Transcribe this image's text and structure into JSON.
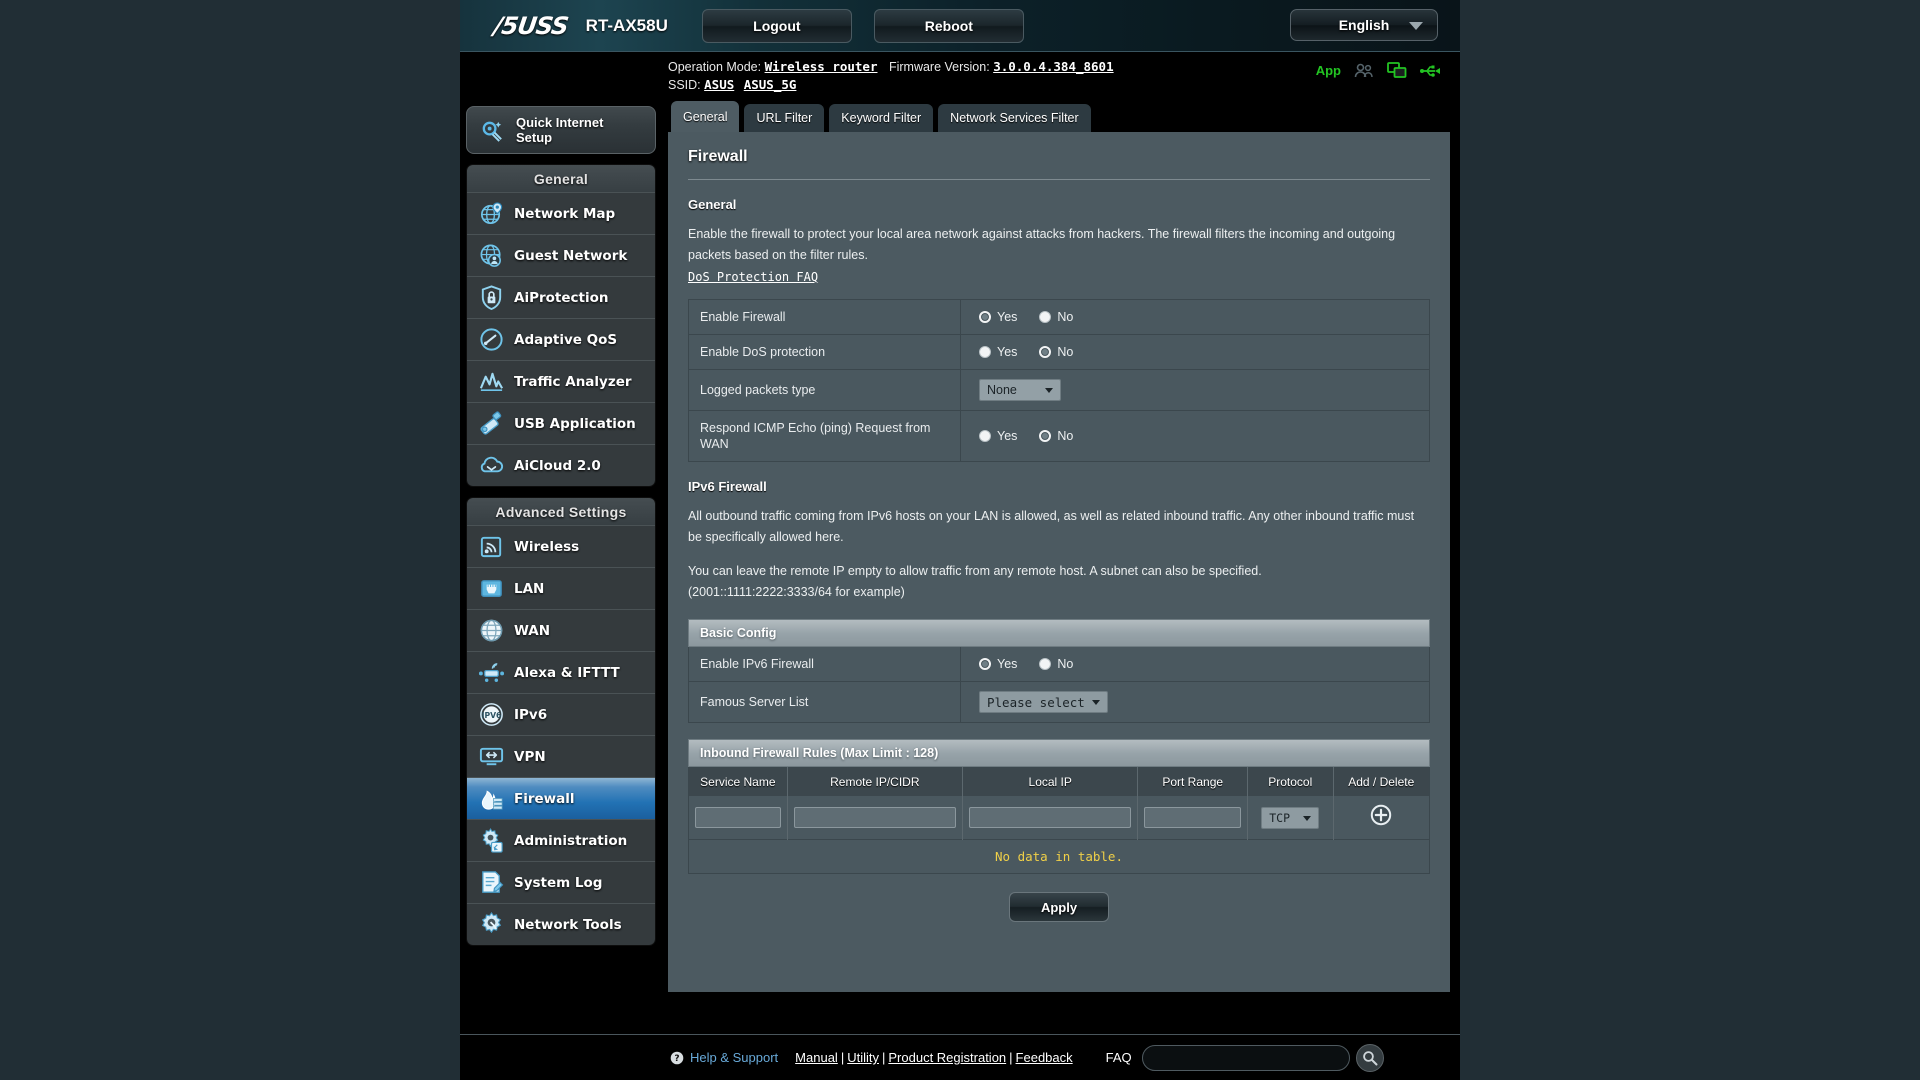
{
  "banner": {
    "brand": "/5USS",
    "brand_text": "ASUS",
    "model": "RT-AX58U",
    "logout_label": "Logout",
    "reboot_label": "Reboot",
    "language": "English"
  },
  "info": {
    "operation_mode_label": "Operation Mode:",
    "operation_mode_value": "Wireless router",
    "firmware_label": "Firmware Version:",
    "firmware_value": "3.0.0.4.384_8601",
    "ssid_label": "SSID:",
    "ssid_1": "ASUS",
    "ssid_2": "ASUS_5G",
    "app_label": "App"
  },
  "sidebar": {
    "quick_setup": "Quick Internet Setup",
    "general_header": "General",
    "general_items": [
      {
        "label": "Network Map",
        "icon": "network-map-icon"
      },
      {
        "label": "Guest Network",
        "icon": "guest-network-icon"
      },
      {
        "label": "AiProtection",
        "icon": "shield-lock-icon"
      },
      {
        "label": "Adaptive QoS",
        "icon": "gauge-icon"
      },
      {
        "label": "Traffic Analyzer",
        "icon": "traffic-chart-icon"
      },
      {
        "label": "USB Application",
        "icon": "usb-icon"
      },
      {
        "label": "AiCloud 2.0",
        "icon": "cloud-icon"
      }
    ],
    "advanced_header": "Advanced Settings",
    "advanced_items": [
      {
        "label": "Wireless",
        "icon": "wireless-icon"
      },
      {
        "label": "LAN",
        "icon": "lan-port-icon"
      },
      {
        "label": "WAN",
        "icon": "globe-icon"
      },
      {
        "label": "Alexa & IFTTT",
        "icon": "alexa-ifttt-icon"
      },
      {
        "label": "IPv6",
        "icon": "ipv6-icon"
      },
      {
        "label": "VPN",
        "icon": "vpn-icon"
      },
      {
        "label": "Firewall",
        "icon": "firewall-flame-icon",
        "active": true
      },
      {
        "label": "Administration",
        "icon": "administration-gear-icon"
      },
      {
        "label": "System Log",
        "icon": "system-log-icon"
      },
      {
        "label": "Network Tools",
        "icon": "network-tools-icon"
      }
    ]
  },
  "tabs": [
    {
      "label": "General",
      "active": true
    },
    {
      "label": "URL Filter",
      "active": false
    },
    {
      "label": "Keyword Filter",
      "active": false
    },
    {
      "label": "Network Services Filter",
      "active": false
    }
  ],
  "page": {
    "title": "Firewall",
    "general_heading": "General",
    "general_desc": "Enable the firewall to protect your local area network against attacks from hackers. The firewall filters the incoming and outgoing packets based on the filter rules.",
    "dos_faq_link": "DoS Protection FAQ",
    "ipv6_heading": "IPv6 Firewall",
    "ipv6_desc_1": "All outbound traffic coming from IPv6 hosts on your LAN is allowed, as well as related inbound traffic. Any other inbound traffic must be specifically allowed here.",
    "ipv6_desc_2": "You can leave the remote IP empty to allow traffic from any remote host. A subnet can also be specified.",
    "ipv6_desc_3": "(2001::1111:2222:3333/64 for example)",
    "basic_config_header": "Basic Config",
    "rules_header": "Inbound Firewall Rules (Max Limit : 128)",
    "no_data": "No data in table.",
    "apply_label": "Apply"
  },
  "settings": {
    "yes_label": "Yes",
    "no_label": "No",
    "rows": [
      {
        "label": "Enable Firewall",
        "type": "radio",
        "selected": "Yes"
      },
      {
        "label": "Enable DoS protection",
        "type": "radio",
        "selected": "No"
      },
      {
        "label": "Logged packets type",
        "type": "select",
        "value": "None"
      },
      {
        "label": "Respond ICMP Echo (ping) Request from WAN",
        "type": "radio",
        "selected": "No"
      }
    ]
  },
  "ipv6_settings": {
    "enable_label": "Enable IPv6 Firewall",
    "enable_selected": "Yes",
    "famous_label": "Famous Server List",
    "famous_value": "Please select"
  },
  "rules_table": {
    "columns": [
      "Service Name",
      "Remote IP/CIDR",
      "Local IP",
      "Port Range",
      "Protocol",
      "Add / Delete"
    ],
    "input_row": {
      "service_name": "",
      "remote_ip": "",
      "local_ip": "",
      "port_range": "",
      "protocol": "TCP"
    },
    "rows": []
  },
  "footer": {
    "help_label": "Help & Support",
    "links": [
      "Manual",
      "Utility",
      "Product Registration",
      "Feedback"
    ],
    "faq_label": "FAQ",
    "faq_value": "",
    "faq_placeholder": ""
  },
  "colors": {
    "accent_blue": "#2272b4",
    "panel_bg": "#4c5a61",
    "sidebar_item": "#343a3d",
    "status_green": "#23c423",
    "warning_yellow": "#f0d048"
  }
}
